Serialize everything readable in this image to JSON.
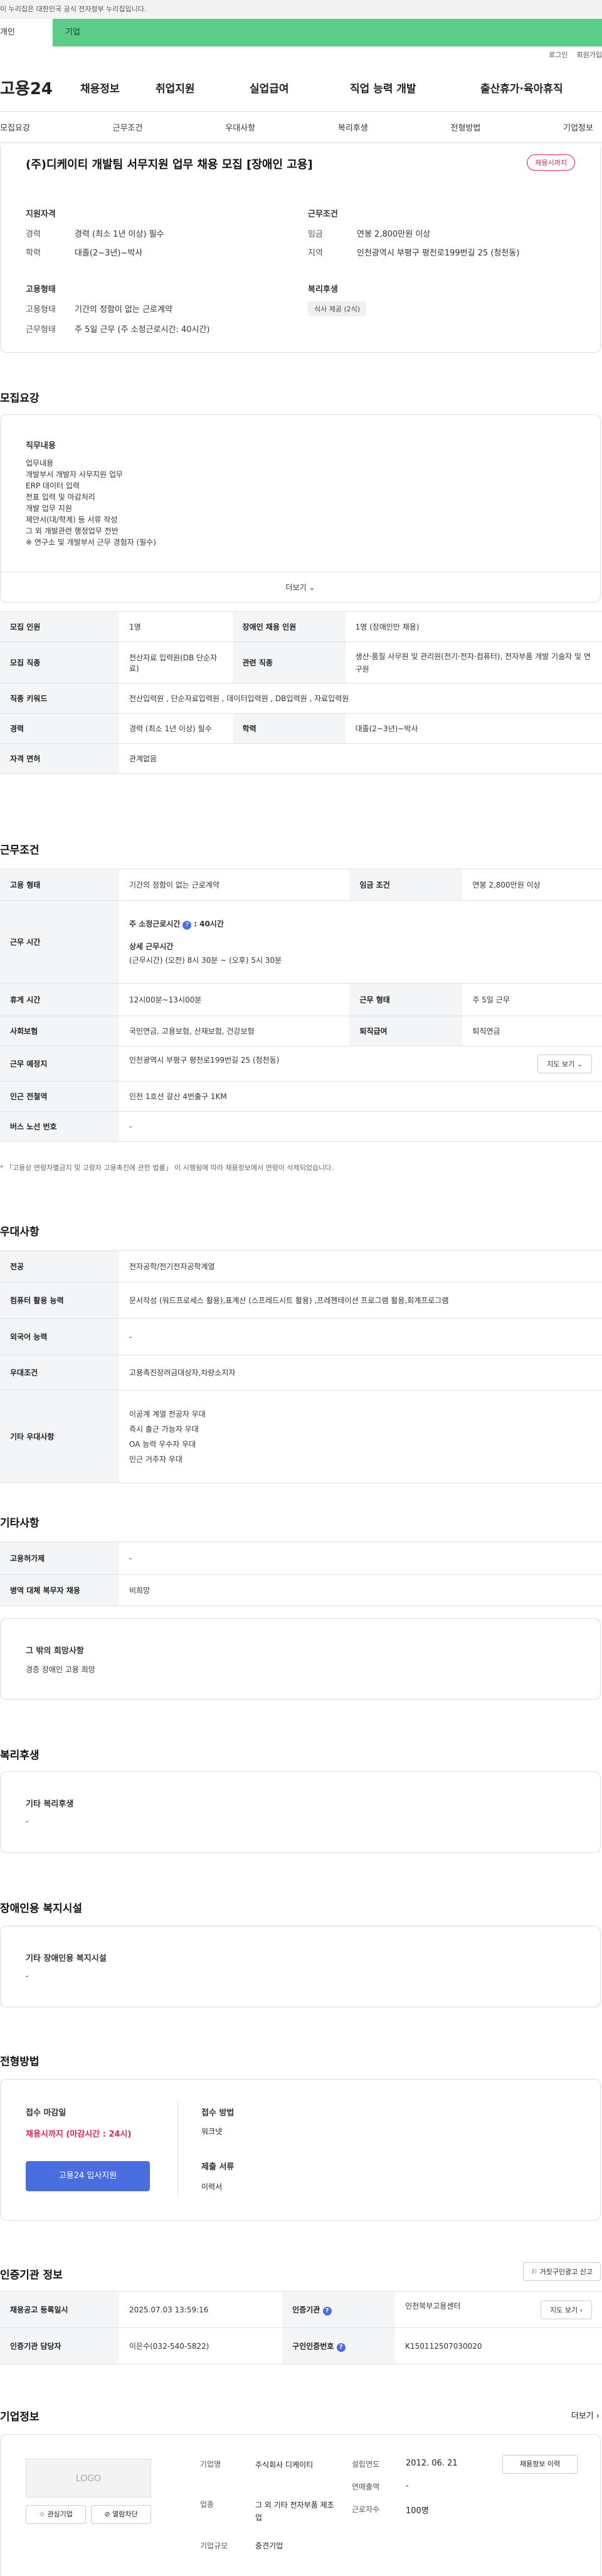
{
  "top": {
    "gov_notice": "이 누리집은 대한민국 공식 전자정부 누리집입니다.",
    "tab_individual": "개인",
    "tab_business": "기업",
    "login": "로그인",
    "join": "회원가입"
  },
  "gnb": {
    "logo": "고용24",
    "items": [
      "채용정보",
      "취업지원",
      "실업급여",
      "직업 능력 개발",
      "출산휴가·육아휴직"
    ]
  },
  "subnav": [
    "모집요강",
    "근무조건",
    "우대사항",
    "복리후생",
    "전형방법",
    "기업정보"
  ],
  "header": {
    "title": "(주)디케이티 개발팀 서무지원 업무 채용 모집 [장애인 고용]",
    "badge": "채용시까지",
    "left_h1": "지원자격",
    "career_label": "경력",
    "career": "경력 (최소 1년 이상) 필수",
    "edu_label": "학력",
    "edu": "대졸(2~3년)~박사",
    "left_h2": "고용형태",
    "type_label": "고용형태",
    "type": "기간의 정함이 없는 근로계약",
    "work_label": "근무형태",
    "work": "주 5일 근무 (주 소정근로시간: 40시간)",
    "right_h1": "근무조건",
    "wage_label": "임금",
    "wage": "연봉 2,800만원 이상",
    "place_label": "지역",
    "place": "인천광역시 부평구 평천로199번길 25 (청천동)",
    "right_h2": "복리후생",
    "welfare_chip": "식사 제공 (2식)"
  },
  "recruit": {
    "title": "모집요강",
    "duty_h": "직무내용",
    "duty_lines": [
      "업무내용",
      "개발부서 개발자 사무지원 업무",
      "ERP 데이터 입력",
      "전표 입력 및 마감처리",
      "개발 업무 지원",
      "제안서(대/학계) 등 서류 작성",
      "그 외 개발관련 행정업무 전반",
      "※ 연구소 및 개발부서 근무 경험자 (필수)"
    ],
    "more": "더보기",
    "rows": [
      [
        "모집 인원",
        "1명",
        "장애인 채용 인원",
        "1명 (장애인만 채용)"
      ],
      [
        "모집 직종",
        "전산자료 입력원(DB 단순자료)",
        "관련 직종",
        "생산·품질 사무원 및 관리원(전기·전자·컴퓨터), 전자부품 개발 기술자 및 연구원"
      ],
      [
        "직종 키워드",
        "전산입력원 , 단순자료입력원 , 데이터입력원 , DB입력원 , 자료입력원"
      ],
      [
        "경력",
        "경력 (최소 1년 이상) 필수",
        "학력",
        "대졸(2~3년)~박사"
      ],
      [
        "자격 면허",
        "관계없음"
      ]
    ]
  },
  "work": {
    "title": "근무조건",
    "type_label": "고용 형태",
    "type": "기간의 정함이 없는 근로계약",
    "wage_label": "임금 조건",
    "wage": "연봉 2,800만원 이상",
    "time_label": "근무 시간",
    "time_h": "주 소정근로시간",
    "time_h2": ": 40시간",
    "time_sub": "상세 근무시간",
    "time_detail": "(근무시간) (오전) 8시 30분 ~ (오후) 5시 30분",
    "break_label": "휴게 시간",
    "break": "12시00분~13시00분",
    "form_label": "근무 형태",
    "form": "주 5일 근무",
    "ins_label": "사회보험",
    "ins": "국민연금, 고용보험, 산재보험, 건강보험",
    "ret_label": "퇴직급여",
    "ret": "퇴직연금",
    "loc_label": "근무 예정지",
    "loc": "인천광역시 부평구 평천로199번길 25 (청천동)",
    "map": "지도 보기",
    "sub_label": "인근 전철역",
    "sub": "인천 1호선 갈산 4번출구 1KM",
    "bus_label": "버스 노선 번호",
    "bus": "-",
    "note": "* 「고용상 연령차별금지 및 고령자 고용촉진에 관한 법률」 이 시행됨에 따라 채용정보에서 연령이 삭제되었습니다."
  },
  "pref": {
    "title": "우대사항",
    "rows": [
      [
        "전공",
        "전자공학/전기전자공학계열"
      ],
      [
        "컴퓨터 활용 능력",
        "문서작성 (워드프로세스 활용),표계산 (스프레드시트 활용) ,프레젠테이션 프로그램 활용,회계프로그램"
      ],
      [
        "외국어 능력",
        "-"
      ],
      [
        "우대조건",
        "고용촉진장려금대상자,차량소지자"
      ]
    ],
    "other_label": "기타 우대사항",
    "other_lines": [
      "이공계 계열 전공자 우대",
      "즉시 출근 가능자 우대",
      "OA 능력 우수자 우대",
      "인근 거주자 우대"
    ]
  },
  "etc": {
    "title": "기타사항",
    "rows": [
      [
        "고용허가제",
        "-"
      ],
      [
        "병역 대체 복무자 채용",
        "비희망"
      ]
    ],
    "box_h": "그 밖의 희망사항",
    "box_v": "경증 장애인 고용 희망"
  },
  "welfare": {
    "title": "복리후생",
    "h": "기타 복리후생",
    "v": "-"
  },
  "disabled": {
    "title": "장애인용 복지시설",
    "h": "기타 장애인용 복지시설",
    "v": "-"
  },
  "process": {
    "title": "전형방법",
    "deadline_h": "접수 마감일",
    "deadline": "채용시까지 (마감시간 : 24시)",
    "apply_btn": "고용24 입사지원",
    "method_h": "접수 방법",
    "method": "워크넷",
    "docs_h": "제출 서류",
    "docs": "이력서"
  },
  "agency": {
    "title": "인증기관 정보",
    "report": "거짓구인광고 신고",
    "reg_label": "채용공고 등록일시",
    "reg": "2025.07.03 13:59:16",
    "org_label": "인증기관",
    "org": "인천북부고용센터",
    "map": "지도 보기",
    "mgr_label": "인증기관 담당자",
    "mgr": "이은수(032-540-5822)",
    "num_label": "구인인증번호",
    "num": "K150112507030020"
  },
  "company": {
    "title": "기업정보",
    "more": "더보기",
    "logo": "LOGO",
    "fav": "관심기업",
    "block": "열람차단",
    "history": "채용정보 이력",
    "name_label": "기업명",
    "name": "주식회사 디케이티",
    "ind_label": "업종",
    "ind": "그 외 기타 전자부품 제조업",
    "size_label": "기업규모",
    "size": "중견기업",
    "est_label": "설립연도",
    "est": "2012. 06. 21",
    "sales_label": "연매출액",
    "sales": "-",
    "emp_label": "근로자수",
    "emp": "100명"
  },
  "colors": {
    "accent_green": "#5ccc89",
    "badge_red": "#e0245e",
    "apply_blue": "#4a6ee0"
  }
}
